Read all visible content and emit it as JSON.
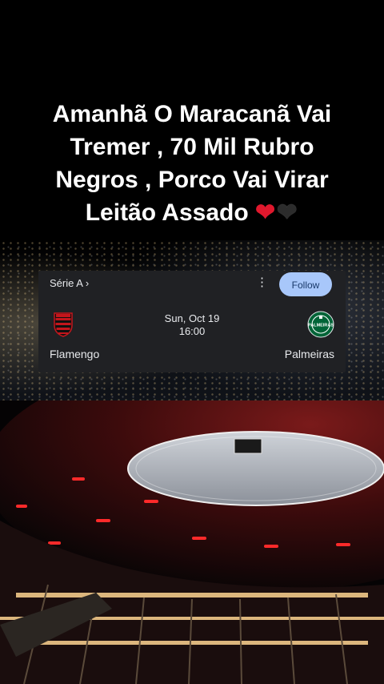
{
  "caption": {
    "line1": "Amanhã O Maracanã Vai",
    "line2": "Tremer , 70 Mil Rubro",
    "line3": "Negros , Porco Vai Virar",
    "line4": "Leitão Assado",
    "heart1": "❤",
    "heart2": "❤"
  },
  "card": {
    "league": "Série A",
    "league_chevron": "›",
    "more_icon": "⋮",
    "follow_label": "Follow",
    "date": "Sun, Oct 19",
    "time": "16:00",
    "home_team": "Flamengo",
    "away_team": "Palmeiras",
    "away_crest_text": "PALMEIRAS"
  },
  "colors": {
    "card_bg": "#202124",
    "follow_bg": "#a8c7fa",
    "flamengo_red": "#c4161c",
    "palmeiras_green": "#006437",
    "heart_red": "#e0182d"
  }
}
